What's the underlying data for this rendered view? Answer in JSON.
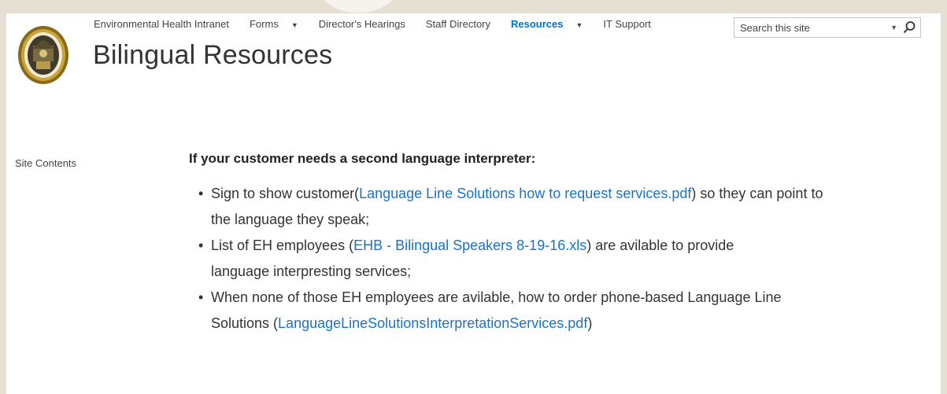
{
  "nav": {
    "items": [
      {
        "label": "Environmental Health Intranet",
        "dropdown": false,
        "active": false
      },
      {
        "label": "Forms",
        "dropdown": true,
        "active": false
      },
      {
        "label": "Director's Hearings",
        "dropdown": false,
        "active": false
      },
      {
        "label": "Staff Directory",
        "dropdown": false,
        "active": false
      },
      {
        "label": "Resources",
        "dropdown": true,
        "active": true
      },
      {
        "label": "IT Support",
        "dropdown": false,
        "active": false
      }
    ]
  },
  "search": {
    "placeholder": "Search this site"
  },
  "page_title": "Bilingual Resources",
  "left_nav": {
    "site_contents": "Site Contents"
  },
  "content": {
    "heading": "If your customer needs a second language interpreter:",
    "items": [
      {
        "before": "Sign to show customer(",
        "link": "Language Line Solutions how to request services.pdf",
        "after": ") so they can point to the language they speak;"
      },
      {
        "before": "List of EH employees (",
        "link": "EHB - Bilingual Speakers 8-19-16.xls",
        "after": ") are avilable to provide language interpresting services;"
      },
      {
        "before": "When none of those EH employees are avilable, how to order phone-based Language Line Solutions (",
        "link": "LanguageLineSolutionsInterpretationServices.pdf",
        "after": ")"
      }
    ]
  },
  "colors": {
    "link": "#1b73c4",
    "active_nav": "#0072c6",
    "frame": "#e6e0d4"
  }
}
